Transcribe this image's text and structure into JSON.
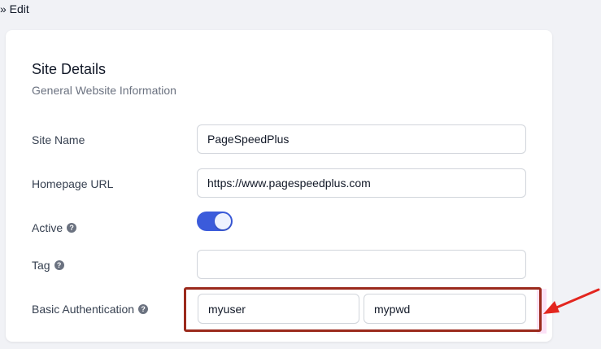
{
  "breadcrumb": {
    "text": "» Edit"
  },
  "card": {
    "title": "Site Details",
    "subtitle": "General Website Information"
  },
  "fields": {
    "site_name": {
      "label": "Site Name",
      "value": "PageSpeedPlus"
    },
    "homepage_url": {
      "label": "Homepage URL",
      "value": "https://www.pagespeedplus.com"
    },
    "active": {
      "label": "Active",
      "enabled": true
    },
    "tag": {
      "label": "Tag",
      "value": ""
    },
    "basic_auth": {
      "label": "Basic Authentication",
      "username": "myuser",
      "password": "mypwd"
    }
  },
  "icons": {
    "help": "?"
  },
  "colors": {
    "toggle_on": "#3b5bdb",
    "annotation": "#9b2a1c",
    "arrow": "#e3261f"
  }
}
